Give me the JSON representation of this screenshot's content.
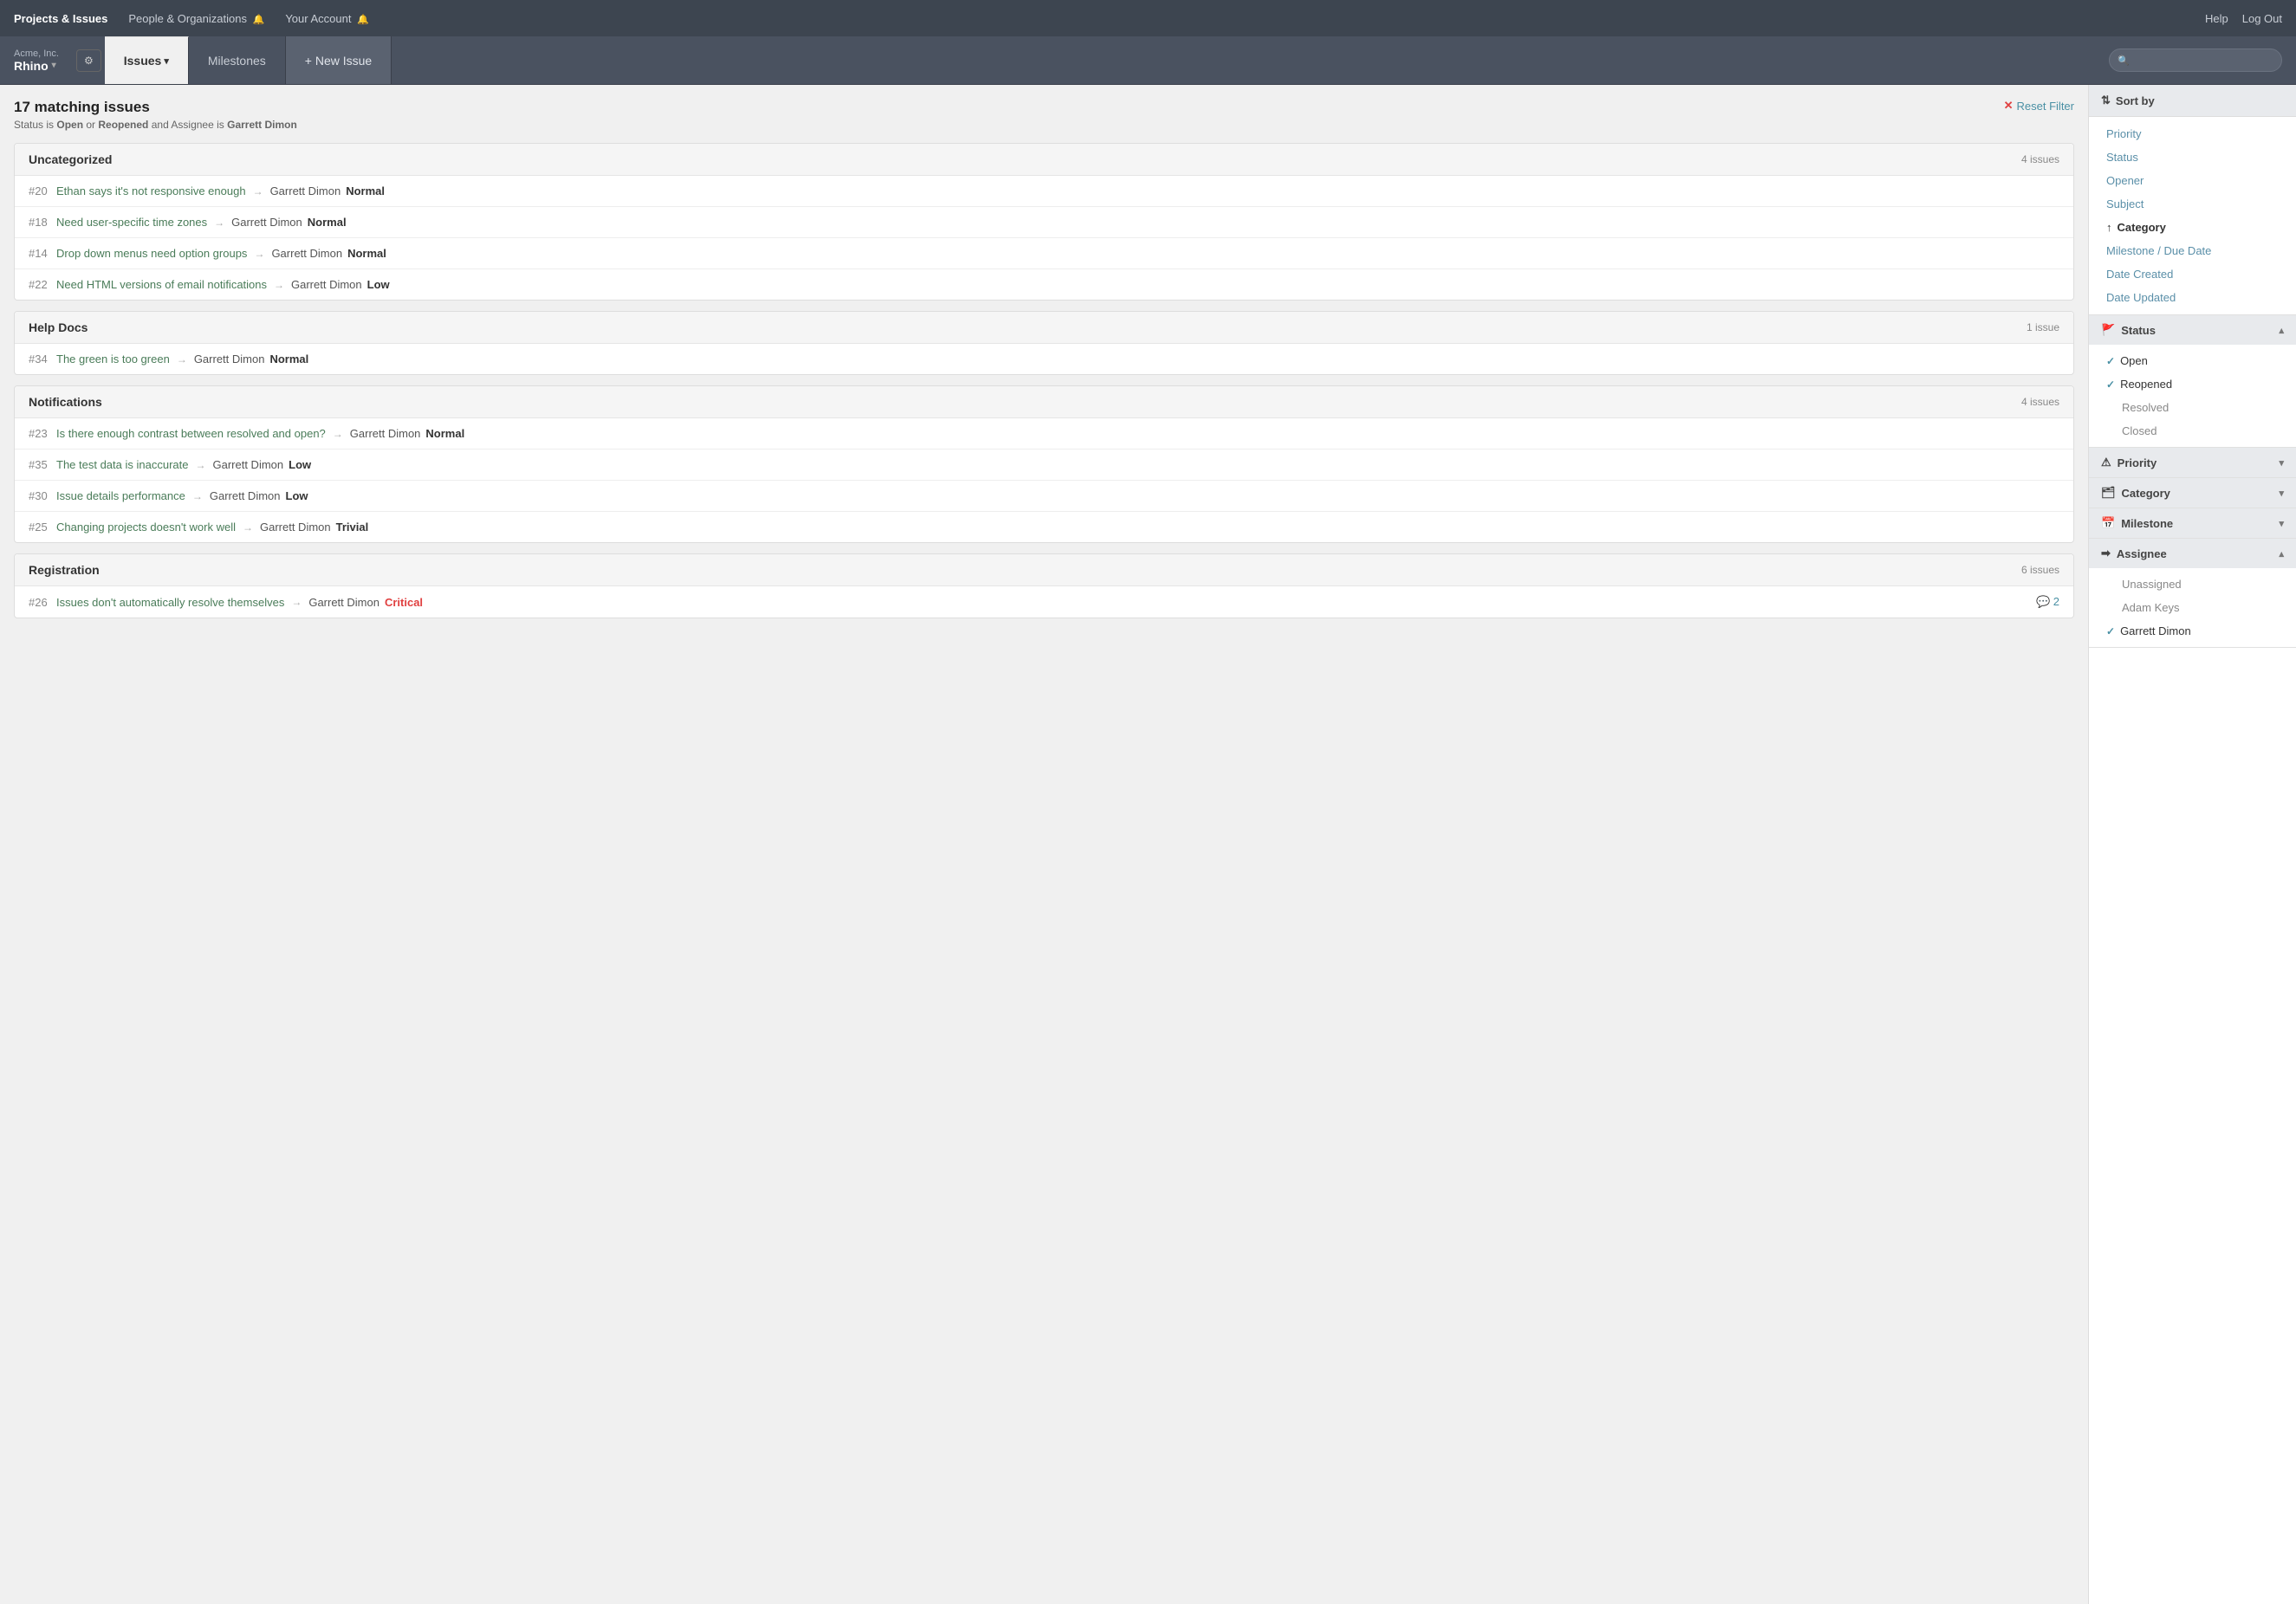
{
  "topNav": {
    "links": [
      {
        "label": "Projects & Issues",
        "active": true
      },
      {
        "label": "People & Organizations",
        "active": false,
        "bell": true
      },
      {
        "label": "Your Account",
        "active": false,
        "bell": true
      }
    ],
    "rightLinks": [
      {
        "label": "Help"
      },
      {
        "label": "Log Out"
      }
    ]
  },
  "subNav": {
    "companyName": "Acme, Inc.",
    "projectName": "Rhino",
    "tabs": [
      {
        "label": "Issues",
        "active": true,
        "dropdown": true
      },
      {
        "label": "Milestones",
        "active": false
      },
      {
        "label": "+ New Issue",
        "active": false,
        "isNew": true
      }
    ],
    "searchPlaceholder": ""
  },
  "issues": {
    "count": "17 matching issues",
    "filterDesc": "Status is Open or Reopened and Assignee is Garrett Dimon",
    "resetFilter": "Reset Filter",
    "groups": [
      {
        "name": "Uncategorized",
        "count": "4 issues",
        "items": [
          {
            "number": "#20",
            "title": "Ethan says it's not responsive enough",
            "assignee": "Garrett Dimon",
            "priority": "Normal",
            "priorityClass": ""
          },
          {
            "number": "#18",
            "title": "Need user-specific time zones",
            "assignee": "Garrett Dimon",
            "priority": "Normal",
            "priorityClass": ""
          },
          {
            "number": "#14",
            "title": "Drop down menus need option groups",
            "assignee": "Garrett Dimon",
            "priority": "Normal",
            "priorityClass": ""
          },
          {
            "number": "#22",
            "title": "Need HTML versions of email notifications",
            "assignee": "Garrett Dimon",
            "priority": "Low",
            "priorityClass": "low"
          }
        ]
      },
      {
        "name": "Help Docs",
        "count": "1 issue",
        "items": [
          {
            "number": "#34",
            "title": "The green is too green",
            "assignee": "Garrett Dimon",
            "priority": "Normal",
            "priorityClass": ""
          }
        ]
      },
      {
        "name": "Notifications",
        "count": "4 issues",
        "items": [
          {
            "number": "#23",
            "title": "Is there enough contrast between resolved and open?",
            "assignee": "Garrett Dimon",
            "priority": "Normal",
            "priorityClass": ""
          },
          {
            "number": "#35",
            "title": "The test data is inaccurate",
            "assignee": "Garrett Dimon",
            "priority": "Low",
            "priorityClass": "low"
          },
          {
            "number": "#30",
            "title": "Issue details performance",
            "assignee": "Garrett Dimon",
            "priority": "Low",
            "priorityClass": "low"
          },
          {
            "number": "#25",
            "title": "Changing projects doesn't work well",
            "assignee": "Garrett Dimon",
            "priority": "Trivial",
            "priorityClass": ""
          }
        ]
      },
      {
        "name": "Registration",
        "count": "6 issues",
        "items": [
          {
            "number": "#26",
            "title": "Issues don't automatically resolve themselves",
            "assignee": "Garrett Dimon",
            "priority": "Critical",
            "priorityClass": "critical",
            "comments": 2
          }
        ]
      }
    ]
  },
  "sidebar": {
    "sortBy": "Sort by",
    "sortItems": [
      {
        "label": "Priority",
        "active": false
      },
      {
        "label": "Status",
        "active": false
      },
      {
        "label": "Opener",
        "active": false
      },
      {
        "label": "Subject",
        "active": false
      },
      {
        "label": "Category",
        "active": true
      },
      {
        "label": "Milestone / Due Date",
        "active": false
      },
      {
        "label": "Date Created",
        "active": false
      },
      {
        "label": "Date Updated",
        "active": false
      }
    ],
    "filters": [
      {
        "name": "Status",
        "icon": "🚩",
        "collapsed": false,
        "items": [
          {
            "label": "Open",
            "checked": true
          },
          {
            "label": "Reopened",
            "checked": true
          },
          {
            "label": "Resolved",
            "checked": false
          },
          {
            "label": "Closed",
            "checked": false
          }
        ]
      },
      {
        "name": "Priority",
        "icon": "⚠",
        "collapsed": true,
        "items": []
      },
      {
        "name": "Category",
        "icon": "🗂",
        "collapsed": true,
        "items": []
      },
      {
        "name": "Milestone",
        "icon": "📅",
        "collapsed": true,
        "items": []
      },
      {
        "name": "Assignee",
        "icon": "➡",
        "collapsed": false,
        "items": [
          {
            "label": "Unassigned",
            "checked": false
          },
          {
            "label": "Adam Keys",
            "checked": false
          },
          {
            "label": "Garrett Dimon",
            "checked": true
          }
        ]
      }
    ]
  }
}
